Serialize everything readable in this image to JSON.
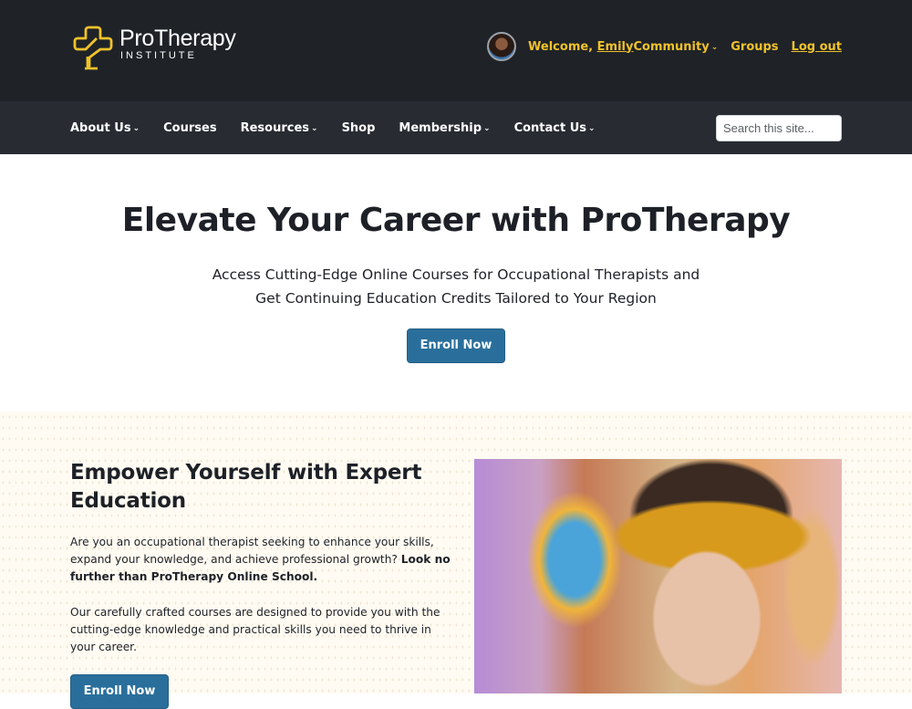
{
  "header": {
    "logo": {
      "name": "ProTherapy",
      "subtitle": "INSTITUTE",
      "icon": "cross-plus-icon",
      "color": "#f1c22b"
    },
    "user_nav": {
      "avatar": "user-avatar",
      "welcome_prefix": "Welcome, ",
      "user_name": "Emily",
      "items": [
        {
          "label": "Community",
          "has_dropdown": true
        },
        {
          "label": "Groups",
          "has_dropdown": false
        },
        {
          "label": "Log out",
          "has_dropdown": false
        }
      ]
    }
  },
  "nav": {
    "items": [
      {
        "label": "About Us",
        "has_dropdown": true
      },
      {
        "label": "Courses",
        "has_dropdown": false
      },
      {
        "label": "Resources",
        "has_dropdown": true
      },
      {
        "label": "Shop",
        "has_dropdown": false
      },
      {
        "label": "Membership",
        "has_dropdown": true
      },
      {
        "label": "Contact Us",
        "has_dropdown": true
      }
    ],
    "search": {
      "placeholder": "Search this site...",
      "value": ""
    },
    "chevron": "⌄"
  },
  "hero": {
    "title": "Elevate Your Career with ProTherapy",
    "subtitle_line1": "Access Cutting-Edge Online Courses for Occupational Therapists and",
    "subtitle_line2": "Get Continuing Education Credits Tailored to Your Region",
    "cta_label": "Enroll Now"
  },
  "section": {
    "title": "Empower Yourself with Expert Education",
    "paragraph1": "Are you an occupational therapist seeking to enhance your skills, expand your knowledge, and achieve professional growth? ",
    "paragraph1_bold": "Look no further than ProTherapy Online School.",
    "paragraph2": "Our carefully crafted courses are designed to provide you with the cutting-edge knowledge and practical skills you need to thrive in your career.",
    "cta_label": "Enroll Now",
    "image_alt": "Smiling woman with paint-covered hands and yellow headband"
  },
  "colors": {
    "header_bg": "#1f2328",
    "nav_bg": "#282c32",
    "accent_yellow": "#f1c22b",
    "button_blue": "#2a6f9b",
    "section_bg": "#fffbf2"
  }
}
